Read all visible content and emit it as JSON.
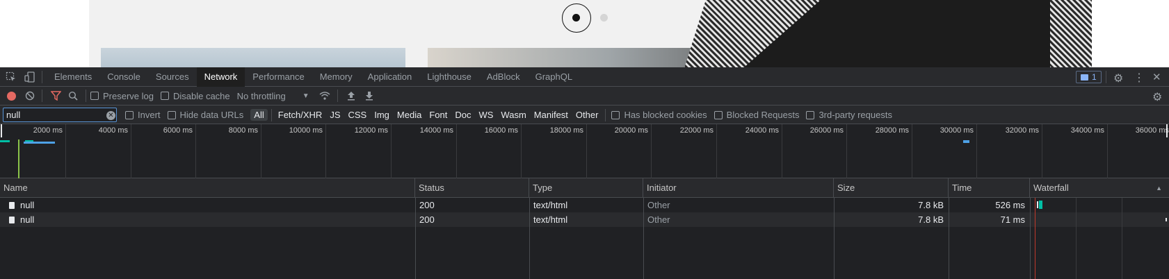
{
  "devtools": {
    "tabs": [
      "Elements",
      "Console",
      "Sources",
      "Network",
      "Performance",
      "Memory",
      "Application",
      "Lighthouse",
      "AdBlock",
      "GraphQL"
    ],
    "active_tab": "Network",
    "issues_count": "1",
    "icons": [
      "inspect-icon",
      "device-toggle-icon",
      "chat-icon",
      "gear-icon",
      "kebab-menu-icon",
      "close-icon"
    ]
  },
  "toolbar": {
    "preserve_log": "Preserve log",
    "disable_cache": "Disable cache",
    "throttling": "No throttling",
    "icons": [
      "record-icon",
      "clear-icon",
      "filter-icon",
      "search-icon",
      "wifi-settings-icon",
      "upload-icon",
      "download-icon",
      "settings-icon"
    ]
  },
  "filter": {
    "value": "null",
    "invert": "Invert",
    "hide_data_urls": "Hide data URLs",
    "types": [
      "All",
      "Fetch/XHR",
      "JS",
      "CSS",
      "Img",
      "Media",
      "Font",
      "Doc",
      "WS",
      "Wasm",
      "Manifest",
      "Other"
    ],
    "active_type": "All",
    "has_blocked_cookies": "Has blocked cookies",
    "blocked_requests": "Blocked Requests",
    "third_party": "3rd-party requests"
  },
  "overview": {
    "ticks": [
      "2000 ms",
      "4000 ms",
      "6000 ms",
      "8000 ms",
      "10000 ms",
      "12000 ms",
      "14000 ms",
      "16000 ms",
      "18000 ms",
      "20000 ms",
      "22000 ms",
      "24000 ms",
      "26000 ms",
      "28000 ms",
      "30000 ms",
      "32000 ms",
      "34000 ms",
      "36000 ms"
    ]
  },
  "table": {
    "columns": [
      "Name",
      "Status",
      "Type",
      "Initiator",
      "Size",
      "Time",
      "Waterfall"
    ],
    "rows": [
      {
        "name": "null",
        "status": "200",
        "type": "text/html",
        "initiator": "Other",
        "size": "7.8 kB",
        "time": "526 ms"
      },
      {
        "name": "null",
        "status": "200",
        "type": "text/html",
        "initiator": "Other",
        "size": "7.8 kB",
        "time": "71 ms"
      }
    ]
  },
  "colors": {
    "accent": "#8ab4f8",
    "record": "#e46962",
    "waterfall_bar": "#00bfa5",
    "load_line": "#e46962"
  }
}
